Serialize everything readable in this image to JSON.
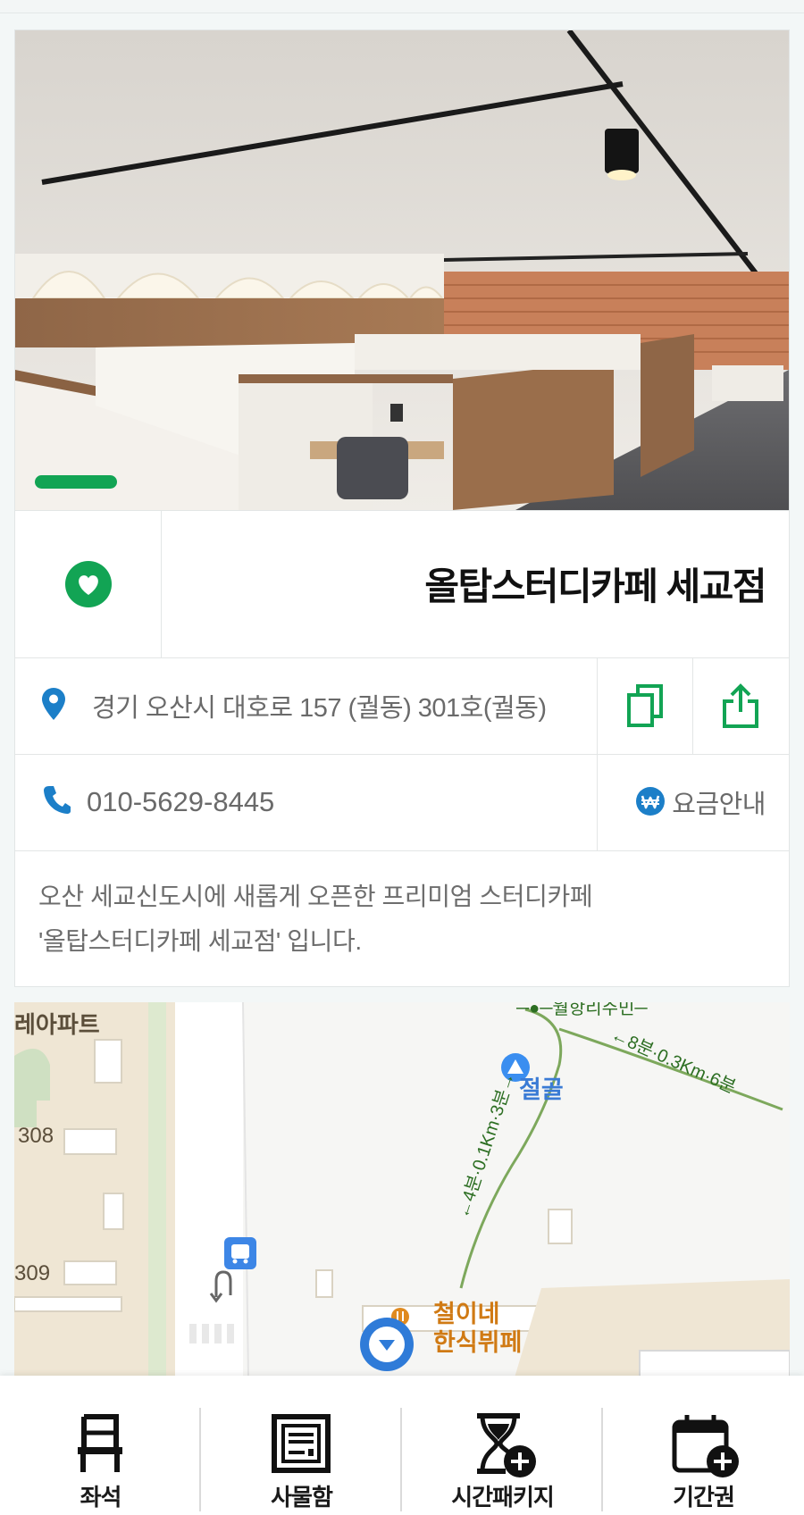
{
  "store": {
    "name": "올탑스터디카페 세교점",
    "address": "경기 오산시 대호로 157 (궐동) 301호(궐동)",
    "phone": "010-5629-8445",
    "fee_label": "요금안내",
    "description_lines": [
      "오산 세교신도시에 새롭게 오픈한 프리미엄 스터디카페",
      "'올탑스터디카페 세교점' 입니다."
    ]
  },
  "photo": {
    "carousel_index": 1
  },
  "colors": {
    "accent": "#12a454",
    "blue_icon": "#1c7fc8",
    "text_muted": "#6a6a6a"
  },
  "icons": {
    "favorite": "heart-icon",
    "location": "map-pin-icon",
    "copy": "copy-icon",
    "share": "share-icon",
    "phone": "phone-icon",
    "fee": "won-icon"
  },
  "map": {
    "labels": {
      "apartment": "레아파트",
      "bld_308": "308",
      "bld_309": "309",
      "temple": "절골",
      "route_1": "←4분·0.1Km·3분→",
      "route_2": "←8분·0.3Km·6분",
      "route_top": "─●─월항리주민─",
      "restaurant_line1": "철이네",
      "restaurant_line2": "한식뷔페"
    }
  },
  "nav": {
    "items": [
      {
        "label": "좌석",
        "icon": "chair-icon"
      },
      {
        "label": "사물함",
        "icon": "locker-icon"
      },
      {
        "label": "시간패키지",
        "icon": "hourglass-plus-icon"
      },
      {
        "label": "기간권",
        "icon": "calendar-plus-icon"
      }
    ]
  }
}
